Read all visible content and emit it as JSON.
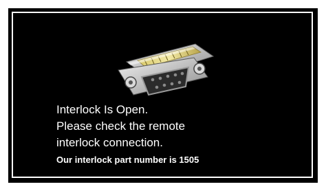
{
  "dialog": {
    "image_icon": "db9-gender-changer-connector-icon",
    "line1": "Interlock Is Open.",
    "line2": "Please check the remote",
    "line3": "interlock connection.",
    "line4": "Our interlock part number is 1505"
  },
  "colors": {
    "background": "#000000",
    "border": "#ffffff",
    "text": "#ffffff"
  }
}
